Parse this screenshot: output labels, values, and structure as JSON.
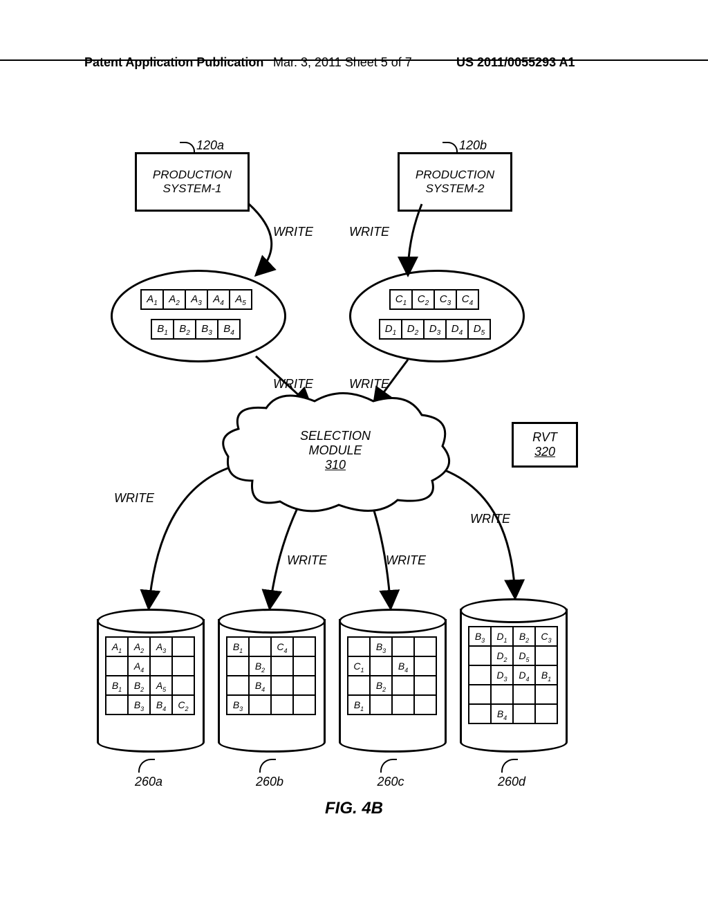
{
  "header": {
    "left": "Patent Application Publication",
    "center": "Mar. 3, 2011  Sheet 5 of 7",
    "right": "US 2011/0055293 A1"
  },
  "refs": {
    "prod1": "120a",
    "prod2": "120b"
  },
  "prod1": {
    "line1": "PRODUCTION",
    "line2": "SYSTEM-1"
  },
  "prod2": {
    "line1": "PRODUCTION",
    "line2": "SYSTEM-2"
  },
  "write_labels": {
    "w1": "WRITE",
    "w2": "WRITE",
    "w3": "WRITE",
    "w4": "WRITE",
    "w5": "WRITE",
    "w6": "WRITE",
    "w7": "WRITE",
    "w8": "WRITE"
  },
  "logs_left": {
    "rowA": [
      "A<sub>1</sub>",
      "A<sub>2</sub>",
      "A<sub>3</sub>",
      "A<sub>4</sub>",
      "A<sub>5</sub>"
    ],
    "rowB": [
      "B<sub>1</sub>",
      "B<sub>2</sub>",
      "B<sub>3</sub>",
      "B<sub>4</sub>"
    ]
  },
  "logs_right": {
    "rowC": [
      "C<sub>1</sub>",
      "C<sub>2</sub>",
      "C<sub>3</sub>",
      "C<sub>4</sub>"
    ],
    "rowD": [
      "D<sub>1</sub>",
      "D<sub>2</sub>",
      "D<sub>3</sub>",
      "D<sub>4</sub>",
      "D<sub>5</sub>"
    ]
  },
  "selection": {
    "line1": "SELECTION",
    "line2": "MODULE",
    "num": "310"
  },
  "rvt": {
    "label": "RVT",
    "num": "320"
  },
  "cyl_a": {
    "label": "260a",
    "grid": [
      [
        "A<sub>1</sub>",
        "A<sub>2</sub>",
        "A<sub>3</sub>",
        ""
      ],
      [
        "",
        "A<sub>4</sub>",
        "",
        ""
      ],
      [
        "B<sub>1</sub>",
        "B<sub>2</sub>",
        "A<sub>5</sub>",
        ""
      ],
      [
        "",
        "B<sub>3</sub>",
        "B<sub>4</sub>",
        "C<sub>2</sub>"
      ]
    ]
  },
  "cyl_b": {
    "label": "260b",
    "grid": [
      [
        "B<sub>1</sub>",
        "",
        "C<sub>4</sub>",
        ""
      ],
      [
        "",
        "B<sub>2</sub>",
        "",
        ""
      ],
      [
        "",
        "B<sub>4</sub>",
        "",
        ""
      ],
      [
        "B<sub>3</sub>",
        "",
        "",
        ""
      ]
    ]
  },
  "cyl_c": {
    "label": "260c",
    "grid": [
      [
        "",
        "B<sub>3</sub>",
        "",
        ""
      ],
      [
        "C<sub>1</sub>",
        "",
        "B<sub>4</sub>",
        ""
      ],
      [
        "",
        "B<sub>2</sub>",
        "",
        ""
      ],
      [
        "B<sub>1</sub>",
        "",
        "",
        ""
      ]
    ]
  },
  "cyl_d": {
    "label": "260d",
    "grid": [
      [
        "B<sub>3</sub>",
        "D<sub>1</sub>",
        "B<sub>2</sub>",
        "C<sub>3</sub>"
      ],
      [
        "",
        "D<sub>2</sub>",
        "D<sub>5</sub>",
        ""
      ],
      [
        "",
        "D<sub>3</sub>",
        "D<sub>4</sub>",
        "B<sub>1</sub>"
      ],
      [
        "",
        "",
        "",
        ""
      ],
      [
        "",
        "B<sub>4</sub>",
        "",
        ""
      ]
    ]
  },
  "figure": "FIG. 4B"
}
